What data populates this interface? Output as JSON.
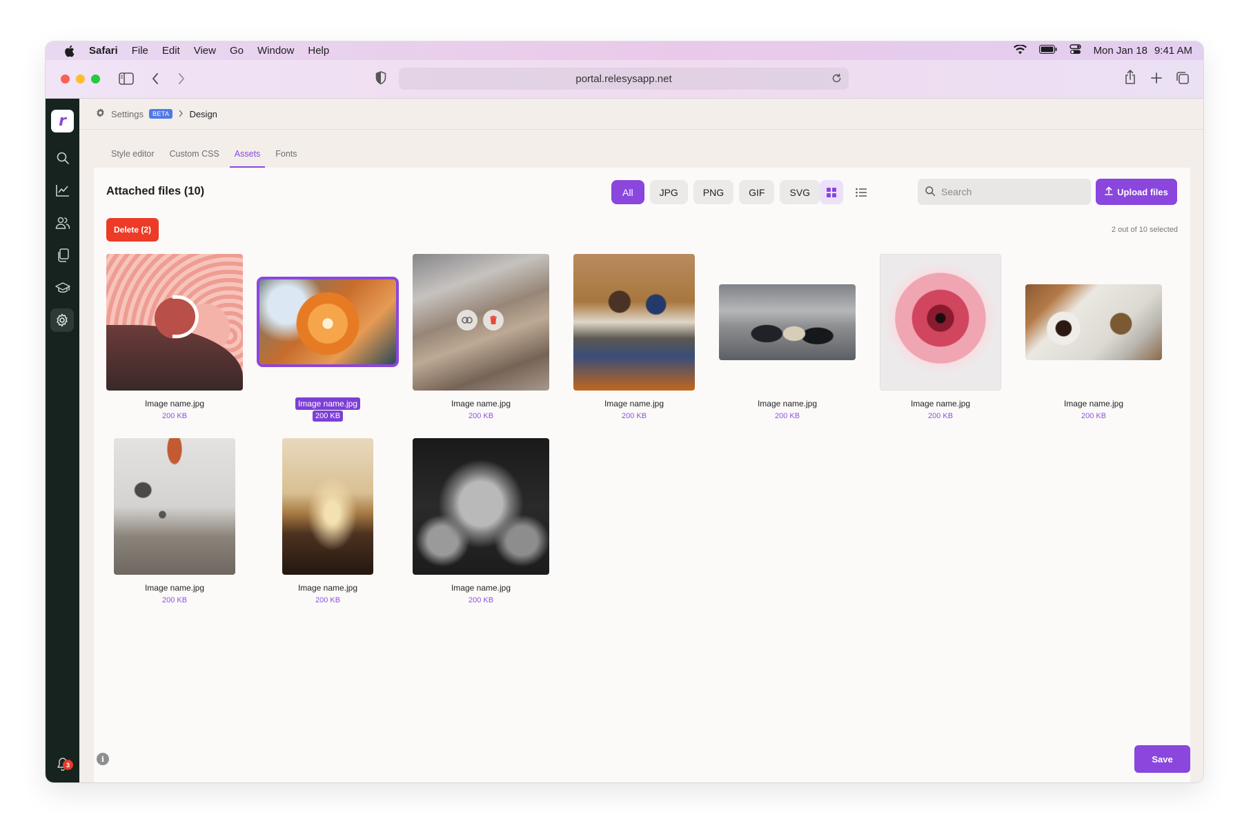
{
  "menubar": {
    "app": "Safari",
    "items": [
      "File",
      "Edit",
      "View",
      "Go",
      "Window",
      "Help"
    ],
    "date": "Mon Jan 18",
    "time": "9:41 AM"
  },
  "browser": {
    "url": "portal.relesysapp.net"
  },
  "sidebar": {
    "logo": "r",
    "items": [
      "search-icon",
      "chart-icon",
      "users-icon",
      "pages-icon",
      "academy-icon",
      "settings-icon"
    ],
    "notification_count": "3"
  },
  "breadcrumb": {
    "root": "Settings",
    "badge": "BETA",
    "current": "Design"
  },
  "tabs": [
    {
      "label": "Style editor",
      "active": false
    },
    {
      "label": "Custom CSS",
      "active": false
    },
    {
      "label": "Assets",
      "active": true
    },
    {
      "label": "Fonts",
      "active": false
    }
  ],
  "assets": {
    "title": "Attached files (10)",
    "filters": [
      "All",
      "JPG",
      "PNG",
      "GIF",
      "SVG"
    ],
    "active_filter": "All",
    "search_placeholder": "Search",
    "upload_label": "Upload files",
    "delete_label": "Delete (2)",
    "selection_status": "2 out of 10 selected",
    "files": [
      {
        "name": "Image name.jpg",
        "size": "200 KB",
        "subject": "pink abstract shape",
        "selected": false
      },
      {
        "name": "Image name.jpg",
        "size": "200 KB",
        "subject": "orange flower",
        "selected": true
      },
      {
        "name": "Image name.jpg",
        "size": "200 KB",
        "subject": "desert mountains",
        "selected": false
      },
      {
        "name": "Image name.jpg",
        "size": "200 KB",
        "subject": "two people with laptop",
        "selected": false
      },
      {
        "name": "Image name.jpg",
        "size": "200 KB",
        "subject": "group of friends",
        "selected": false
      },
      {
        "name": "Image name.jpg",
        "size": "200 KB",
        "subject": "pink poppy",
        "selected": false
      },
      {
        "name": "Image name.jpg",
        "size": "200 KB",
        "subject": "coffee table flatlay",
        "selected": false
      },
      {
        "name": "Image name.jpg",
        "size": "200 KB",
        "subject": "hot air balloons",
        "selected": false
      },
      {
        "name": "Image name.jpg",
        "size": "200 KB",
        "subject": "sunset mountain",
        "selected": false
      },
      {
        "name": "Image name.jpg",
        "size": "200 KB",
        "subject": "portrait black and white",
        "selected": false
      }
    ]
  },
  "footer": {
    "save_label": "Save",
    "info_glyph": "i"
  },
  "colors": {
    "accent": "#8a46dd",
    "danger": "#ec3b26",
    "sidebar": "#16231f"
  }
}
